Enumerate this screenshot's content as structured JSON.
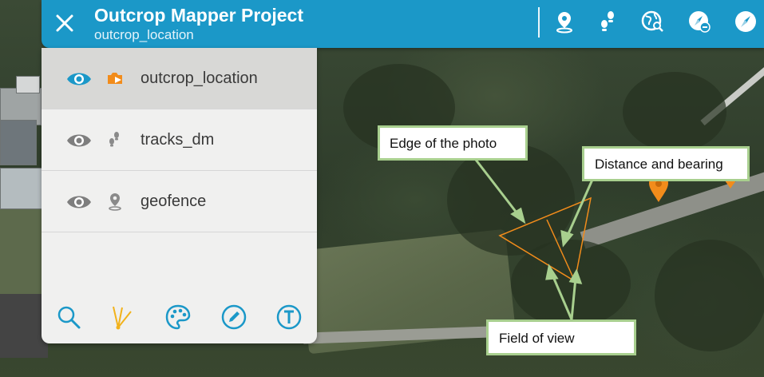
{
  "app": {
    "title": "Outcrop Mapper Project",
    "subtitle": "outcrop_location"
  },
  "toolbar": {
    "icons": [
      "close-icon",
      "location-pin-icon",
      "footprints-icon",
      "globe-search-icon",
      "compass-minus-icon",
      "compass-icon"
    ]
  },
  "layers": [
    {
      "name": "outcrop_location",
      "visible": true,
      "selected": true,
      "icon": "photo-tag-icon"
    },
    {
      "name": "tracks_dm",
      "visible": true,
      "selected": false,
      "icon": "footprints-icon"
    },
    {
      "name": "geofence",
      "visible": true,
      "selected": false,
      "icon": "location-pin-icon"
    }
  ],
  "panel_tools": [
    "search-icon",
    "field-of-view-icon",
    "palette-icon",
    "pencil-icon",
    "text-icon"
  ],
  "annotations": {
    "edge": "Edge of the photo",
    "distance": "Distance and bearing",
    "fov": "Field of view"
  },
  "colors": {
    "accent": "#1b98c8",
    "selected_eye": "#1b98c8",
    "marker": "#f28c1b",
    "callout_border": "#a8cf8e"
  }
}
